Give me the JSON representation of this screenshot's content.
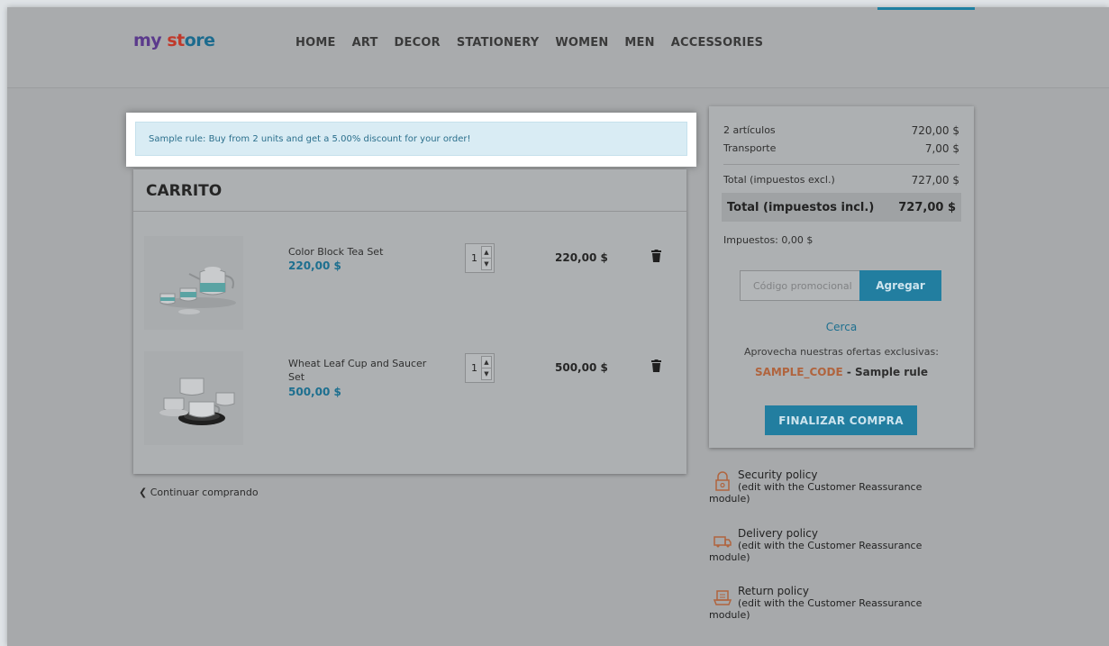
{
  "header": {
    "logo": {
      "part1": "my",
      "part2": "st",
      "part3": "ore"
    },
    "nav": [
      "HOME",
      "ART",
      "DECOR",
      "STATIONERY",
      "WOMEN",
      "MEN",
      "ACCESSORIES"
    ]
  },
  "notice": {
    "text": "Sample rule: Buy from 2 units and get a 5.00% discount for your order!"
  },
  "cart": {
    "title": "CARRITO",
    "items": [
      {
        "name": "Color Block Tea Set",
        "unit_price": "220,00 $",
        "qty": "1",
        "total": "220,00 $",
        "image_icon": "tea-set-image"
      },
      {
        "name": "Wheat Leaf Cup and Saucer Set",
        "unit_price": "500,00 $",
        "qty": "1",
        "total": "500,00 $",
        "image_icon": "cup-saucer-image"
      }
    ],
    "continue_label": "Continuar comprando"
  },
  "summary": {
    "items_label": "2 artículos",
    "items_value": "720,00 $",
    "shipping_label": "Transporte",
    "shipping_value": "7,00 $",
    "total_excl_label": "Total (impuestos excl.)",
    "total_excl_value": "727,00 $",
    "total_incl_label": "Total (impuestos incl.)",
    "total_incl_value": "727,00 $",
    "taxes": "Impuestos: 0,00 $",
    "promo_placeholder": "Código promocional",
    "promo_button": "Agregar",
    "close_link": "Cerca",
    "offers_text": "Aprovecha nuestras ofertas exclusivas:",
    "offer_code": "SAMPLE_CODE",
    "offer_sep": " - ",
    "offer_rule": "Sample rule",
    "checkout_button": "FINALIZAR COMPRA"
  },
  "reassurance": [
    {
      "title": "Security policy",
      "subtitle": "(edit with the Customer Reassurance",
      "tail": "module)",
      "icon": "lock-icon"
    },
    {
      "title": "Delivery policy",
      "subtitle": "(edit with the Customer Reassurance",
      "tail": "module)",
      "icon": "truck-icon"
    },
    {
      "title": "Return policy",
      "subtitle": "(edit with the Customer Reassurance",
      "tail": "module)",
      "icon": "return-box-icon"
    }
  ],
  "colors": {
    "accent": "#227ea0",
    "price_blue": "#1d6f8f",
    "offer_code": "#b0643e",
    "notice_bg": "#d9ecf4"
  }
}
